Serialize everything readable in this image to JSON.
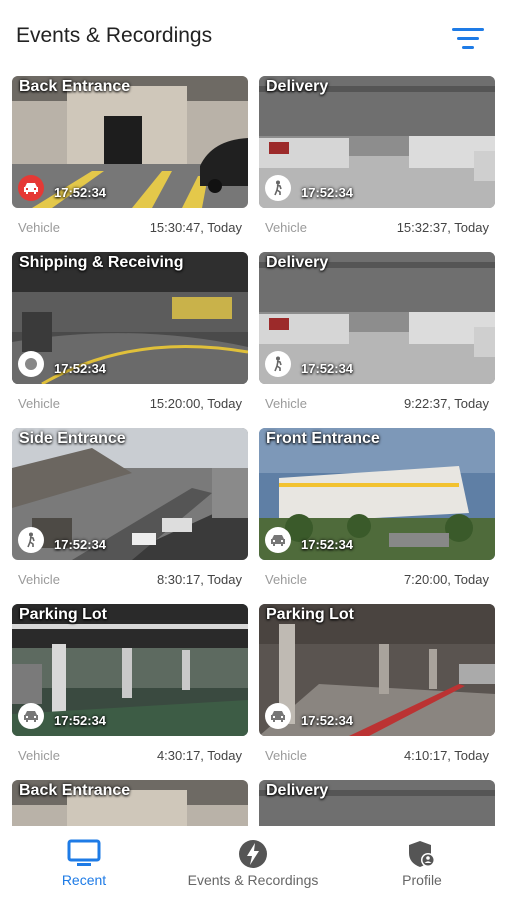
{
  "header": {
    "title": "Events & Recordings",
    "filter_icon": "filter-icon"
  },
  "colors": {
    "accent": "#1e7be6",
    "vehicle_badge": "#e53935"
  },
  "cards": [
    {
      "title": "Back Entrance",
      "badge_time": "17:52:34",
      "kind": "Vehicle",
      "timestamp": "15:30:47, Today",
      "badge_icon": "car-icon",
      "scene": "back"
    },
    {
      "title": "Delivery",
      "badge_time": "17:52:34",
      "kind": "Vehicle",
      "timestamp": "15:32:37, Today",
      "badge_icon": "person-icon",
      "scene": "delivery"
    },
    {
      "title": "Shipping & Receiving",
      "badge_time": "17:52:34",
      "kind": "Vehicle",
      "timestamp": "15:20:00, Today",
      "badge_icon": "record-icon",
      "scene": "shipping"
    },
    {
      "title": "Delivery",
      "badge_time": "17:52:34",
      "kind": "Vehicle",
      "timestamp": "9:22:37, Today",
      "badge_icon": "person-icon",
      "scene": "delivery"
    },
    {
      "title": "Side Entrance",
      "badge_time": "17:52:34",
      "kind": "Vehicle",
      "timestamp": "8:30:17, Today",
      "badge_icon": "person-icon",
      "scene": "street"
    },
    {
      "title": "Front Entrance",
      "badge_time": "17:52:34",
      "kind": "Vehicle",
      "timestamp": "7:20:00, Today",
      "badge_icon": "car-icon",
      "scene": "building"
    },
    {
      "title": "Parking Lot",
      "badge_time": "17:52:34",
      "kind": "Vehicle",
      "timestamp": "4:30:17, Today",
      "badge_icon": "car-icon",
      "scene": "garage"
    },
    {
      "title": "Parking Lot",
      "badge_time": "17:52:34",
      "kind": "Vehicle",
      "timestamp": "4:10:17, Today",
      "badge_icon": "car-icon",
      "scene": "garage2"
    },
    {
      "title": "Back Entrance",
      "scene": "back"
    },
    {
      "title": "Delivery",
      "scene": "delivery"
    }
  ],
  "nav": {
    "items": [
      {
        "label": "Recent",
        "icon": "monitor-icon",
        "active": true
      },
      {
        "label": "Events & Recordings",
        "icon": "lightning-icon",
        "active": false
      },
      {
        "label": "Profile",
        "icon": "shield-user-icon",
        "active": false
      }
    ]
  }
}
